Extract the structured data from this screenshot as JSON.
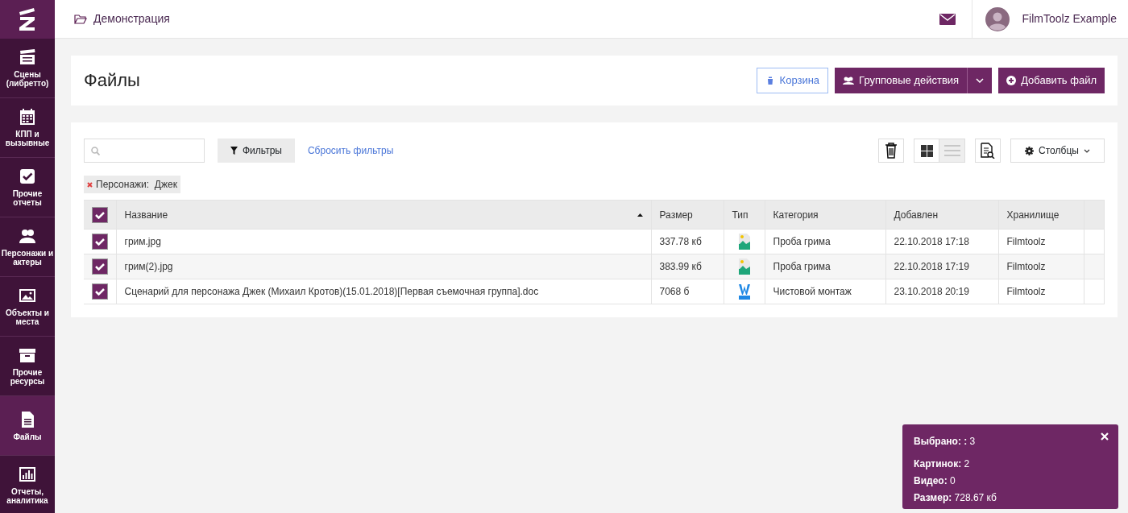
{
  "sidebar": {
    "items": [
      {
        "label": "Сцены (либретто)",
        "selected": false
      },
      {
        "label": "КПП и вызывные",
        "selected": false
      },
      {
        "label": "Прочие отчеты",
        "selected": false
      },
      {
        "label": "Персонажи и актеры",
        "selected": false
      },
      {
        "label": "Объекты и места",
        "selected": false
      },
      {
        "label": "Прочие ресурсы",
        "selected": false
      },
      {
        "label": "Файлы",
        "selected": true
      },
      {
        "label": "Отчеты, аналитика",
        "selected": false
      }
    ]
  },
  "topbar": {
    "breadcrumb": "Демонстрация",
    "user": "FilmToolz Example"
  },
  "header": {
    "title": "Файлы",
    "buttons": [
      {
        "kind": "outline",
        "label": "Корзина"
      },
      {
        "kind": "split",
        "label": "Групповые действия"
      },
      {
        "kind": "solid",
        "label": "Добавить файл"
      }
    ]
  },
  "toolbar": {
    "filters_button": "Фильтры",
    "reset_link": "Сбросить фильтры",
    "view_modes": [
      {
        "selected": false
      },
      {
        "selected": true
      }
    ],
    "columns_button": "Столбцы"
  },
  "filter_tags": [
    {
      "field": "Персонажи:",
      "value": "Джек"
    }
  ],
  "table": {
    "all_checked": true,
    "columns": [
      {
        "label": "Название",
        "sorted": true
      },
      {
        "label": "Размер",
        "sorted": false
      },
      {
        "label": "Тип",
        "sorted": false
      },
      {
        "label": "Категория",
        "sorted": false
      },
      {
        "label": "Добавлен",
        "sorted": false
      },
      {
        "label": "Хранилище",
        "sorted": false
      }
    ],
    "rows": [
      {
        "checked": true,
        "name": "грим.jpg",
        "size": "337.78 кб",
        "kind": "image",
        "category": "Проба грима",
        "added": "22.10.2018 17:18",
        "storage": "Filmtoolz"
      },
      {
        "checked": true,
        "name": "грим(2).jpg",
        "size": "383.99 кб",
        "kind": "image",
        "category": "Проба грима",
        "added": "22.10.2018 17:19",
        "storage": "Filmtoolz"
      },
      {
        "checked": true,
        "name": "Сценарий для персонажа Джек (Михаил Кротов)(15.01.2018)[Первая съемочная группа].doc",
        "size": "7068 б",
        "kind": "document",
        "category": "Чистовой монтаж",
        "added": "23.10.2018 20:19",
        "storage": "Filmtoolz"
      }
    ]
  },
  "selection_popup": {
    "lines": [
      {
        "label": "Выбрано: :",
        "value": "3"
      },
      {
        "label": "Картинок:",
        "value": "2"
      },
      {
        "label": "Видео:",
        "value": "0"
      },
      {
        "label": "Размер:",
        "value": "728.67 кб"
      }
    ]
  }
}
